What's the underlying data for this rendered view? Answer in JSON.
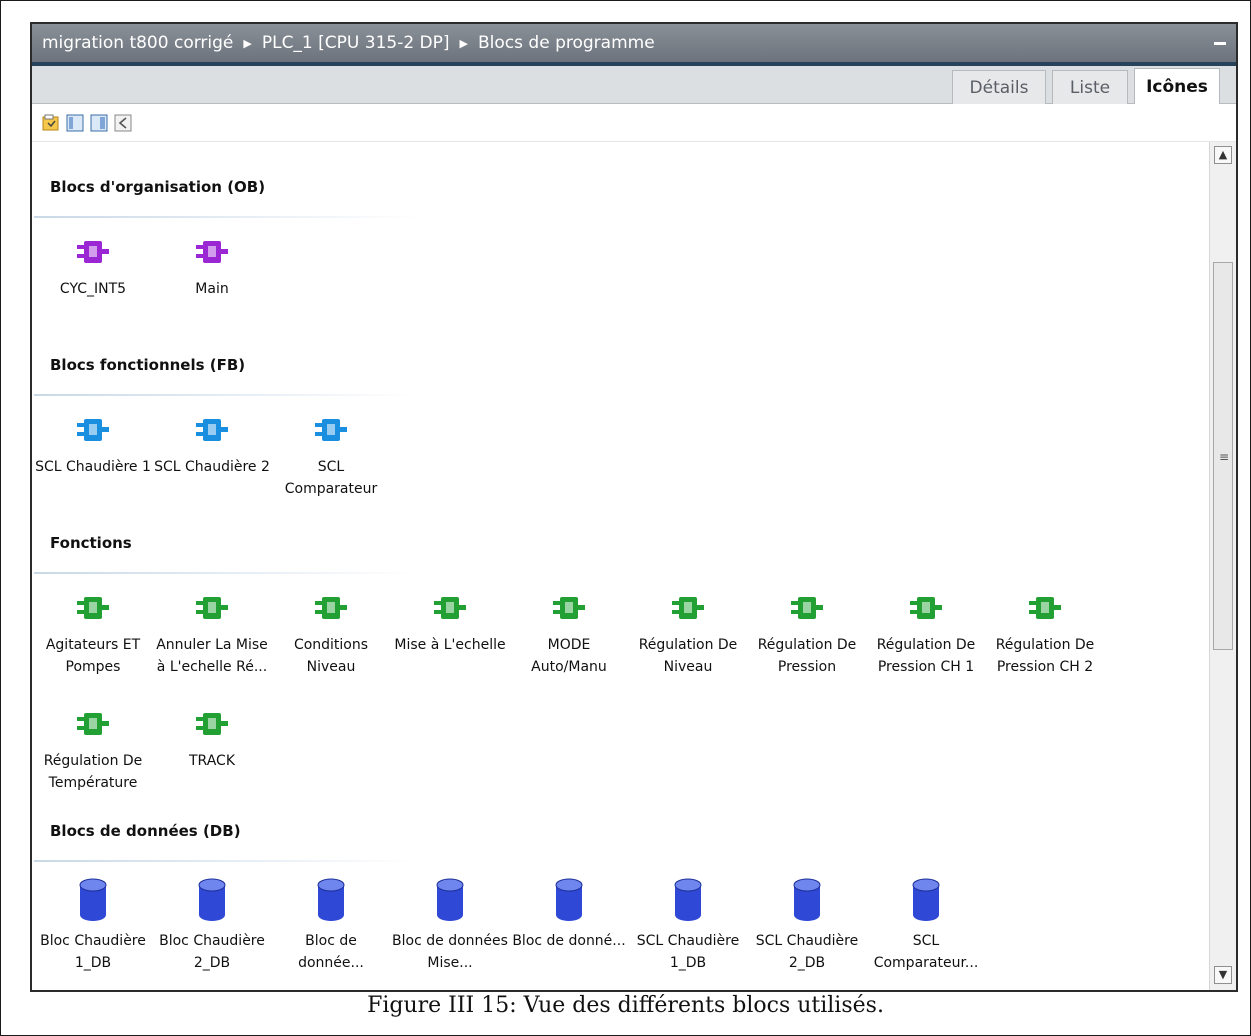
{
  "breadcrumb": [
    "migration t800 corrigé",
    "PLC_1 [CPU 315-2 DP]",
    "Blocs de programme"
  ],
  "tabs": [
    {
      "label": "Détails",
      "active": false
    },
    {
      "label": "Liste",
      "active": false
    },
    {
      "label": "Icônes",
      "active": true
    }
  ],
  "toolbar": [
    "new-folder-icon",
    "view-panel-icon",
    "view-split-icon",
    "collapse-icon"
  ],
  "colors": {
    "ob": "#9b27d4",
    "fb": "#1b8fdf",
    "fc": "#22a033",
    "db": "#2f49d6"
  },
  "sections": [
    {
      "title": "Blocs d'organisation (OB)",
      "kind": "ob",
      "rows": [
        [
          {
            "label": "CYC_INT5"
          },
          {
            "label": "Main"
          }
        ]
      ]
    },
    {
      "title": "Blocs fonctionnels (FB)",
      "kind": "fb",
      "rows": [
        [
          {
            "label": "SCL Chaudière 1"
          },
          {
            "label": "SCL Chaudière 2"
          },
          {
            "label": "SCL Comparateur"
          }
        ]
      ]
    },
    {
      "title": "Fonctions",
      "kind": "fc",
      "rows": [
        [
          {
            "label": "Agitateurs ET Pompes"
          },
          {
            "label": "Annuler La Mise à L'echelle Ré..."
          },
          {
            "label": "Conditions Niveau"
          },
          {
            "label": "Mise à L'echelle"
          },
          {
            "label": "MODE Auto/Manu"
          },
          {
            "label": "Régulation De Niveau"
          },
          {
            "label": "Régulation De Pression"
          },
          {
            "label": "Régulation De Pression CH 1"
          },
          {
            "label": "Régulation De Pression CH 2"
          }
        ],
        [
          {
            "label": "Régulation De Température"
          },
          {
            "label": "TRACK"
          }
        ]
      ]
    },
    {
      "title": "Blocs de données (DB)",
      "kind": "db",
      "rows": [
        [
          {
            "label": "Bloc Chaudière 1_DB"
          },
          {
            "label": "Bloc Chaudière 2_DB"
          },
          {
            "label": "Bloc de donnée..."
          },
          {
            "label": "Bloc de données Mise..."
          },
          {
            "label": "Bloc de donné..."
          },
          {
            "label": "SCL Chaudière 1_DB"
          },
          {
            "label": "SCL Chaudière 2_DB"
          },
          {
            "label": "SCL Comparateur..."
          }
        ]
      ]
    }
  ],
  "caption": "Figure III 15: Vue des différents blocs utilisés."
}
